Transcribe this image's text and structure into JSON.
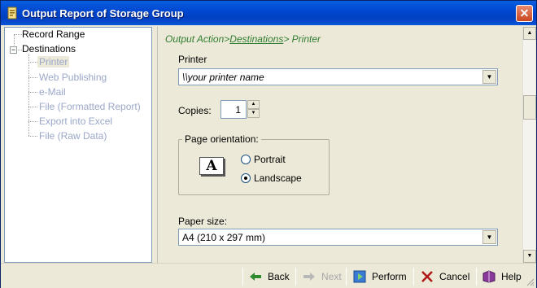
{
  "window": {
    "title": "Output Report of Storage Group",
    "close_symbol": "✕"
  },
  "tree": {
    "items": [
      {
        "label": "Record Range",
        "state": "normal"
      },
      {
        "label": "Destinations",
        "state": "expanded",
        "expander": "−"
      },
      {
        "label": "Printer",
        "state": "selected"
      },
      {
        "label": "Web Publishing",
        "state": "dim"
      },
      {
        "label": "e-Mail",
        "state": "dim"
      },
      {
        "label": "File (Formatted Report)",
        "state": "dim"
      },
      {
        "label": "Export into Excel",
        "state": "dim"
      },
      {
        "label": "File (Raw Data)",
        "state": "dim"
      }
    ]
  },
  "panel": {
    "breadcrumb": {
      "part1": "Output Action>",
      "link": "Destinations",
      "part2": "> Printer"
    },
    "printer": {
      "label": "Printer",
      "value": "\\\\your printer name"
    },
    "copies": {
      "label": "Copies:",
      "value": "1"
    },
    "orientation": {
      "title": "Page orientation:",
      "icon_letter": "A",
      "portrait": "Portrait",
      "landscape": "Landscape",
      "selected": "Landscape"
    },
    "paper": {
      "label": "Paper size:",
      "value": "A4 (210 x 297 mm)"
    }
  },
  "buttons": {
    "back": "Back",
    "next": "Next",
    "perform": "Perform",
    "cancel": "Cancel",
    "help": "Help"
  },
  "colors": {
    "title_bar": "#0048d0",
    "breadcrumb": "#2f7d2f",
    "dim_text": "#9aa7c8"
  }
}
